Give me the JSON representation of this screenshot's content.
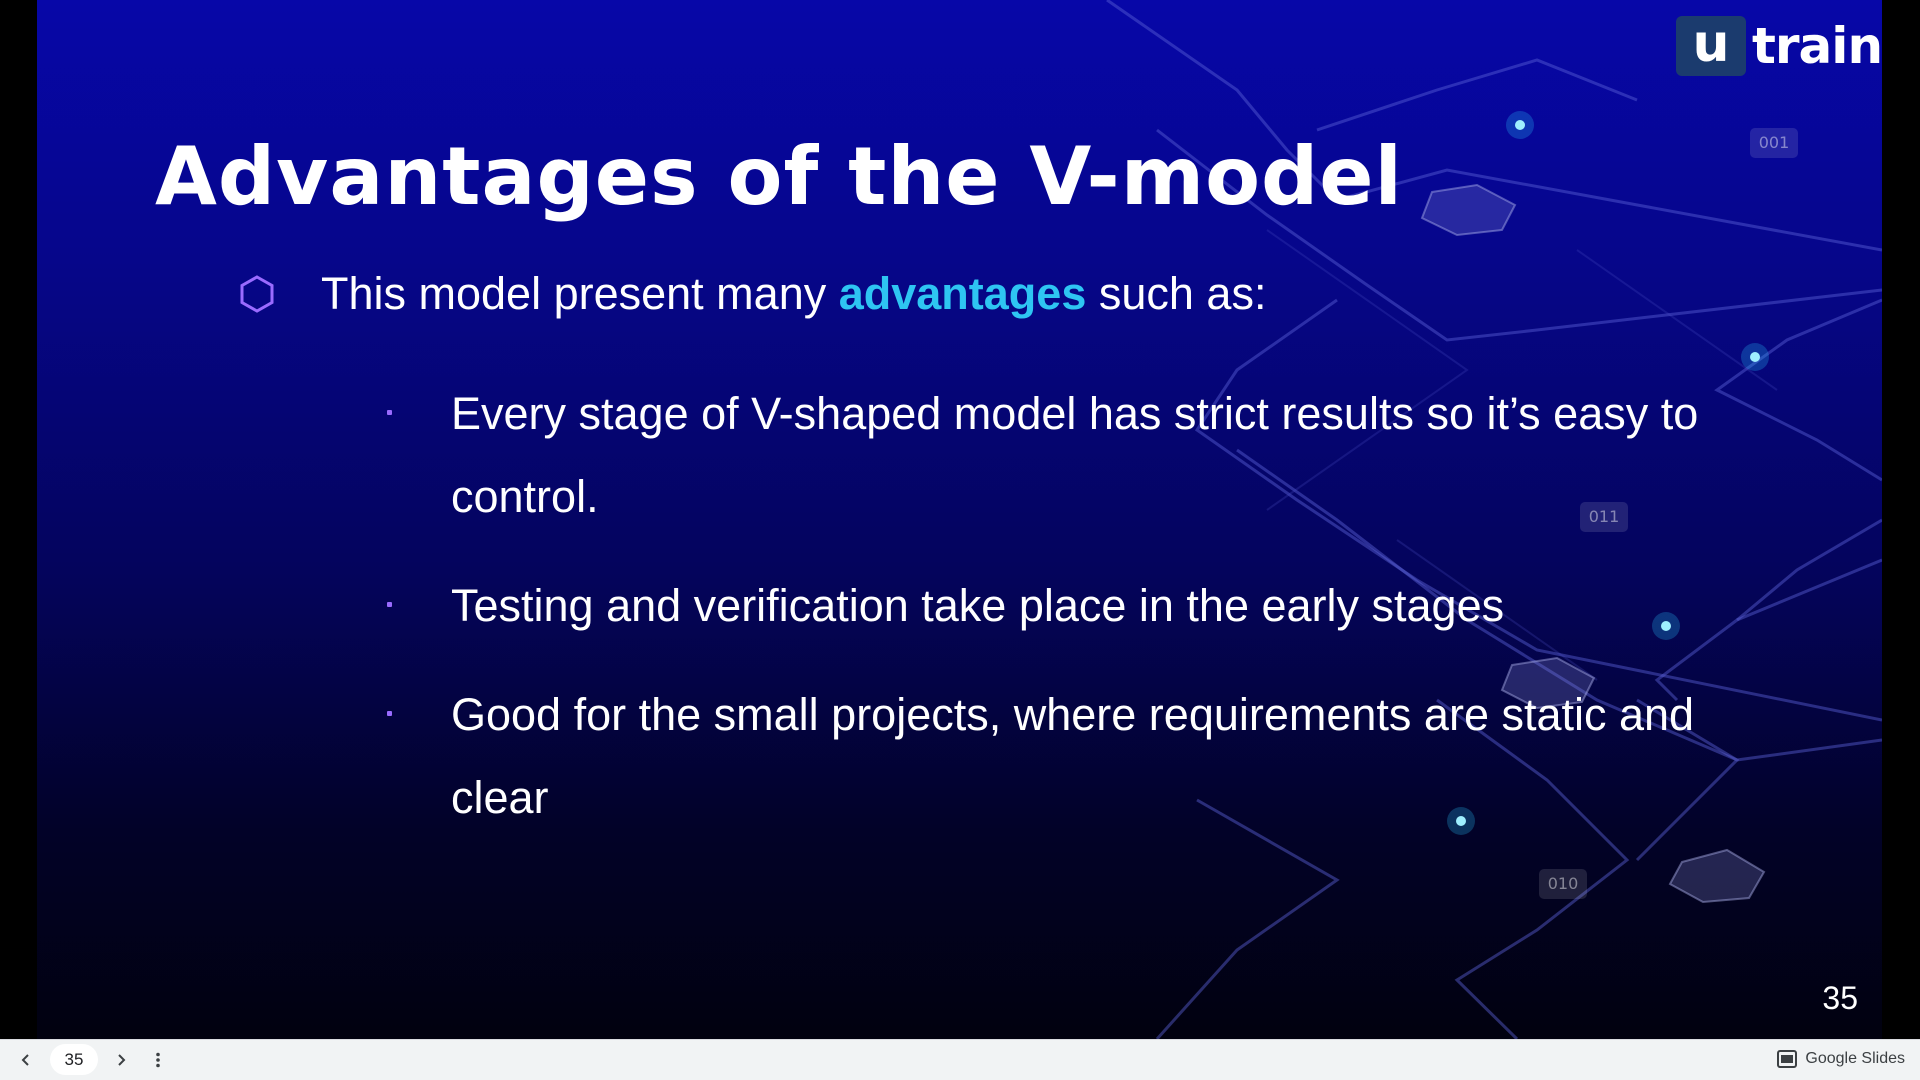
{
  "slide": {
    "logo": {
      "mark": "u",
      "text": "train"
    },
    "title": "Advantages of the V-model",
    "bullet": {
      "prefix": "This model present many ",
      "highlight": "advantages",
      "suffix": " such as:"
    },
    "sub_items": [
      "Every stage of V-shaped model has strict results so it’s easy to control.",
      "Testing and verification take place in the early stages",
      "Good for the small projects, where requirements are static and clear"
    ],
    "binary_tags": [
      "001",
      "011",
      "010"
    ],
    "page_number": "35",
    "colors": {
      "background_top": "#0707a8",
      "background_bottom": "#01010f",
      "highlight": "#2ec5f2",
      "bullet_accent": "#9a6bff"
    }
  },
  "toolbar": {
    "current_slide": "35",
    "brand": "Google Slides",
    "icons": [
      "chevron-left-icon",
      "chevron-right-icon",
      "more-vert-icon",
      "slides-icon"
    ]
  }
}
